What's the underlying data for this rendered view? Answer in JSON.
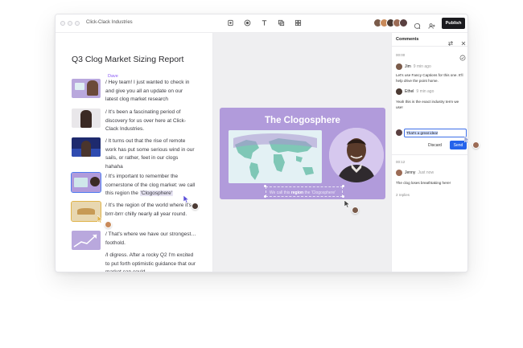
{
  "window": {
    "doc_name": "Click-Clack Industries",
    "publish_label": "Publish"
  },
  "toolbar": {
    "icons": [
      "record-icon",
      "circle-record-icon",
      "text-icon",
      "layers-icon",
      "grid-icon"
    ]
  },
  "collaborators": {
    "colors": [
      "#7a5b4a",
      "#c98a5a",
      "#4b3a33",
      "#9b6b55",
      "#5a4040"
    ]
  },
  "script": {
    "title": "Q3 Clog Market Sizing Report",
    "speaker": "Dave",
    "paragraphs": [
      {
        "text": "/ Hey team! I just wanted to check in and give you all an update on our latest clog market research"
      },
      {
        "text": "/ It's been a fascinating period of discovery for us over here at Click-Clack Industries."
      },
      {
        "text": "/ It turns out that the rise of remote work has put some serious wind in our sails, or rather, feet in our clogs hahaha"
      },
      {
        "text_before": "/ It's important to remember the cornerstone of the clog market: we call this region the ",
        "highlight": "'Clogosphere'"
      },
      {
        "text": "/ It's the region of the world where it's brrr-brrr chilly nearly all year round."
      },
      {
        "text": "/ That's where we have our strongest… foothold."
      },
      {
        "text": "/I digress. After a rocky Q2 I'm excited to put forth optimistic guidance that our market cap could"
      }
    ]
  },
  "slide": {
    "title": "The Clogosphere",
    "caption_before": "We call this ",
    "caption_bold": "region",
    "caption_after": " the 'Clogosphere'"
  },
  "comments": {
    "header": "Comments",
    "thread1": {
      "timestamp": "00:00",
      "c1_author": "Jim",
      "c1_time": "9 min ago",
      "c1_body": "Let's use Fancy Captions for this one. It'll help drive the point home.",
      "c2_author": "Ethel",
      "c2_time": "9 min ago",
      "c2_body": "Yeah this is the exact industry term we use!",
      "reply_text": "That's a great idea!",
      "discard_label": "Discard",
      "send_label": "Send"
    },
    "thread2": {
      "timestamp": "00:12",
      "author": "Jenny",
      "time": "Just now",
      "body": "The clog loses breathtaking here!",
      "replies": "2 replies"
    }
  }
}
